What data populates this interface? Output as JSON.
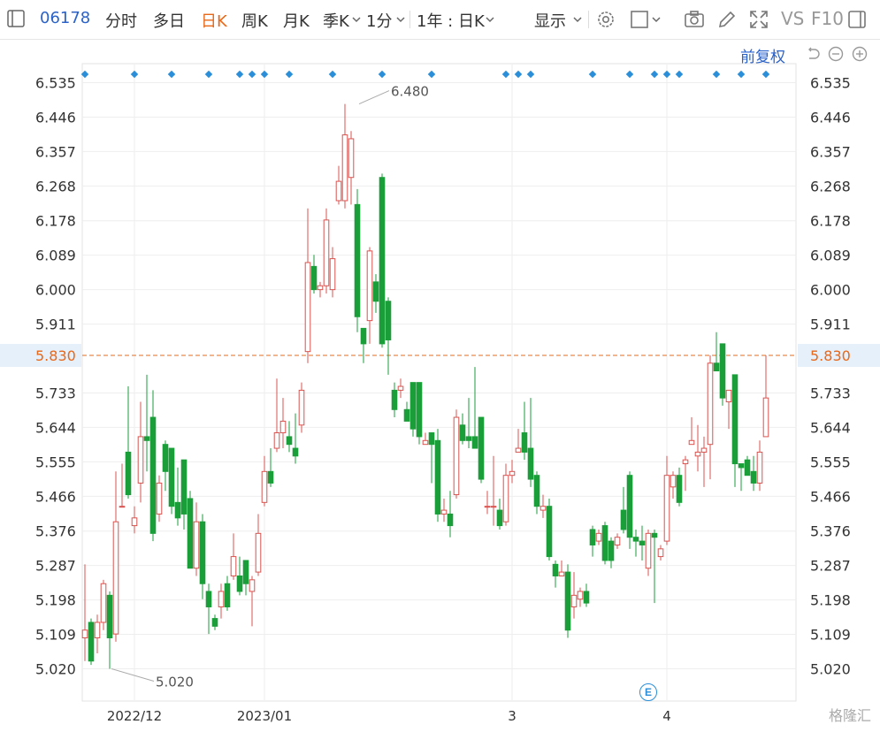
{
  "toolbar": {
    "code": "06178",
    "tabs": [
      "分时",
      "多日",
      "日K",
      "周K",
      "月K",
      "季K",
      "1分"
    ],
    "active_tab": "日K",
    "range_label": "1年 : 日K",
    "display_label": "显示",
    "vs_label": "VS",
    "f10_label": "F10"
  },
  "adjust_label": "前复权",
  "watermark": "格隆汇",
  "event_badge": "E",
  "colors": {
    "up": "#d9534f",
    "down": "#1a9e3a",
    "grid": "#eeeeee",
    "price_line": "#e8681a",
    "marker": "#2a8fd8"
  },
  "chart_data": {
    "type": "candlestick",
    "y_ticks": [
      "6.535",
      "6.446",
      "6.357",
      "6.268",
      "6.178",
      "6.089",
      "6.000",
      "5.911",
      "5.830",
      "5.733",
      "5.644",
      "5.555",
      "5.466",
      "5.376",
      "5.287",
      "5.198",
      "5.109",
      "5.020"
    ],
    "ylim": [
      4.98,
      6.58
    ],
    "x_labels": [
      "2022/12",
      "2023/01",
      "3",
      "4"
    ],
    "x_label_index": [
      8,
      29,
      69,
      94
    ],
    "current_price": 5.83,
    "high_annotation": {
      "label": "6.480",
      "index": 44,
      "value": 6.48
    },
    "low_annotation": {
      "label": "5.020",
      "index": 4,
      "value": 5.02
    },
    "markers_index": [
      0,
      8,
      14,
      20,
      25,
      27,
      29,
      33,
      40,
      48,
      56,
      68,
      70,
      72,
      82,
      88,
      92,
      94,
      96,
      102,
      106,
      110
    ],
    "candles": [
      [
        5.1,
        5.12,
        5.29,
        5.04
      ],
      [
        5.14,
        5.04,
        5.15,
        5.03
      ],
      [
        5.1,
        5.14,
        5.16,
        5.06
      ],
      [
        5.14,
        5.24,
        5.25,
        5.12
      ],
      [
        5.21,
        5.1,
        5.22,
        5.02
      ],
      [
        5.11,
        5.4,
        5.53,
        5.09
      ],
      [
        5.44,
        5.44,
        5.55,
        5.44
      ],
      [
        5.58,
        5.47,
        5.75,
        5.46
      ],
      [
        5.39,
        5.41,
        5.44,
        5.37
      ],
      [
        5.5,
        5.62,
        5.71,
        5.45
      ],
      [
        5.62,
        5.61,
        5.78,
        5.53
      ],
      [
        5.67,
        5.37,
        5.74,
        5.35
      ],
      [
        5.42,
        5.5,
        5.52,
        5.4
      ],
      [
        5.6,
        5.53,
        5.61,
        5.48
      ],
      [
        5.59,
        5.44,
        5.59,
        5.42
      ],
      [
        5.45,
        5.41,
        5.54,
        5.39
      ],
      [
        5.56,
        5.42,
        5.56,
        5.38
      ],
      [
        5.46,
        5.28,
        5.48,
        5.28
      ],
      [
        5.28,
        5.4,
        5.45,
        5.26
      ],
      [
        5.4,
        5.24,
        5.42,
        5.2
      ],
      [
        5.22,
        5.18,
        5.24,
        5.11
      ],
      [
        5.15,
        5.13,
        5.16,
        5.12
      ],
      [
        5.18,
        5.22,
        5.24,
        5.15
      ],
      [
        5.24,
        5.18,
        5.26,
        5.17
      ],
      [
        5.26,
        5.31,
        5.37,
        5.25
      ],
      [
        5.26,
        5.22,
        5.31,
        5.21
      ],
      [
        5.3,
        5.24,
        5.3,
        5.21
      ],
      [
        5.22,
        5.25,
        5.26,
        5.13
      ],
      [
        5.27,
        5.37,
        5.42,
        5.26
      ],
      [
        5.45,
        5.53,
        5.57,
        5.44
      ],
      [
        5.53,
        5.5,
        5.59,
        5.49
      ],
      [
        5.59,
        5.63,
        5.77,
        5.58
      ],
      [
        5.63,
        5.66,
        5.72,
        5.59
      ],
      [
        5.62,
        5.6,
        5.66,
        5.58
      ],
      [
        5.59,
        5.57,
        5.68,
        5.55
      ],
      [
        5.65,
        5.74,
        5.76,
        5.63
      ],
      [
        5.84,
        6.07,
        6.21,
        5.81
      ],
      [
        6.06,
        6.0,
        6.09,
        5.99
      ],
      [
        6.0,
        6.01,
        6.02,
        5.98
      ],
      [
        6.01,
        6.18,
        6.21,
        5.99
      ],
      [
        6.0,
        6.08,
        6.11,
        5.98
      ],
      [
        6.23,
        6.28,
        6.32,
        6.22
      ],
      [
        6.23,
        6.4,
        6.48,
        6.21
      ],
      [
        6.29,
        6.39,
        6.41,
        6.22
      ],
      [
        6.22,
        5.93,
        6.26,
        5.89
      ],
      [
        5.9,
        5.86,
        5.9,
        5.81
      ],
      [
        5.92,
        6.1,
        6.11,
        5.86
      ],
      [
        6.02,
        5.97,
        6.04,
        5.94
      ],
      [
        6.29,
        5.86,
        6.3,
        5.85
      ],
      [
        5.97,
        5.87,
        5.98,
        5.78
      ],
      [
        5.74,
        5.69,
        5.76,
        5.67
      ],
      [
        5.74,
        5.75,
        5.77,
        5.72
      ],
      [
        5.69,
        5.66,
        5.71,
        5.66
      ],
      [
        5.76,
        5.64,
        5.76,
        5.62
      ],
      [
        5.76,
        5.62,
        5.76,
        5.6
      ],
      [
        5.6,
        5.61,
        5.63,
        5.6
      ],
      [
        5.63,
        5.6,
        5.63,
        5.5
      ],
      [
        5.61,
        5.42,
        5.64,
        5.4
      ],
      [
        5.42,
        5.43,
        5.46,
        5.4
      ],
      [
        5.42,
        5.39,
        5.48,
        5.36
      ],
      [
        5.47,
        5.67,
        5.69,
        5.46
      ],
      [
        5.65,
        5.61,
        5.68,
        5.6
      ],
      [
        5.62,
        5.61,
        5.72,
        5.59
      ],
      [
        5.62,
        5.59,
        5.8,
        5.59
      ],
      [
        5.67,
        5.51,
        5.67,
        5.5
      ],
      [
        5.44,
        5.44,
        5.48,
        5.42
      ],
      [
        5.44,
        5.44,
        5.57,
        5.39
      ],
      [
        5.43,
        5.39,
        5.46,
        5.38
      ],
      [
        5.4,
        5.52,
        5.55,
        5.39
      ],
      [
        5.52,
        5.53,
        5.56,
        5.5
      ],
      [
        5.58,
        5.59,
        5.64,
        5.58
      ],
      [
        5.63,
        5.58,
        5.71,
        5.56
      ],
      [
        5.59,
        5.51,
        5.72,
        5.49
      ],
      [
        5.52,
        5.44,
        5.53,
        5.42
      ],
      [
        5.43,
        5.44,
        5.47,
        5.41
      ],
      [
        5.44,
        5.31,
        5.46,
        5.3
      ],
      [
        5.29,
        5.26,
        5.3,
        5.23
      ],
      [
        5.26,
        5.27,
        5.3,
        5.26
      ],
      [
        5.27,
        5.12,
        5.29,
        5.1
      ],
      [
        5.18,
        5.21,
        5.27,
        5.15
      ],
      [
        5.2,
        5.22,
        5.23,
        5.18
      ],
      [
        5.22,
        5.19,
        5.24,
        5.18
      ],
      [
        5.38,
        5.34,
        5.39,
        5.31
      ],
      [
        5.35,
        5.37,
        5.38,
        5.34
      ],
      [
        5.39,
        5.3,
        5.4,
        5.29
      ],
      [
        5.35,
        5.3,
        5.36,
        5.28
      ],
      [
        5.34,
        5.36,
        5.37,
        5.33
      ],
      [
        5.43,
        5.38,
        5.49,
        5.37
      ],
      [
        5.52,
        5.36,
        5.53,
        5.33
      ],
      [
        5.36,
        5.35,
        5.38,
        5.31
      ],
      [
        5.35,
        5.34,
        5.39,
        5.3
      ],
      [
        5.28,
        5.37,
        5.38,
        5.26
      ],
      [
        5.37,
        5.36,
        5.38,
        5.19
      ],
      [
        5.31,
        5.33,
        5.34,
        5.3
      ],
      [
        5.35,
        5.52,
        5.57,
        5.34
      ],
      [
        5.49,
        5.52,
        5.53,
        5.46
      ],
      [
        5.52,
        5.45,
        5.54,
        5.44
      ],
      [
        5.55,
        5.56,
        5.57,
        5.48
      ],
      [
        5.6,
        5.61,
        5.67,
        5.6
      ],
      [
        5.57,
        5.58,
        5.65,
        5.53
      ],
      [
        5.58,
        5.59,
        5.62,
        5.49
      ],
      [
        5.6,
        5.81,
        5.83,
        5.51
      ],
      [
        5.81,
        5.79,
        5.89,
        5.79
      ],
      [
        5.86,
        5.72,
        5.86,
        5.7
      ],
      [
        5.71,
        5.74,
        5.74,
        5.64
      ],
      [
        5.78,
        5.55,
        5.78,
        5.49
      ],
      [
        5.55,
        5.54,
        5.55,
        5.48
      ],
      [
        5.56,
        5.52,
        5.57,
        5.52
      ],
      [
        5.53,
        5.5,
        5.57,
        5.48
      ],
      [
        5.5,
        5.58,
        5.61,
        5.48
      ],
      [
        5.62,
        5.72,
        5.83,
        5.62
      ]
    ]
  }
}
